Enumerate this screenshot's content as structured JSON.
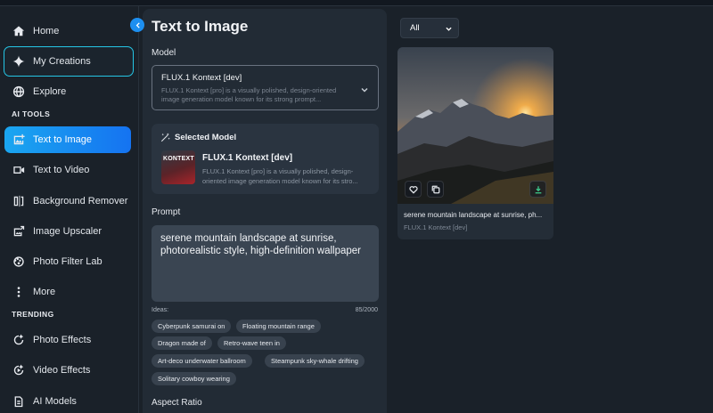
{
  "sidebar": {
    "items": [
      {
        "label": "Home",
        "icon": "home-icon"
      },
      {
        "label": "My Creations",
        "icon": "sparkle-icon"
      },
      {
        "label": "Explore",
        "icon": "globe-icon"
      },
      {
        "label": "Text to Image",
        "icon": "image-plus-icon"
      },
      {
        "label": "Text to Video",
        "icon": "video-icon"
      },
      {
        "label": "Background Remover",
        "icon": "split-icon"
      },
      {
        "label": "Image Upscaler",
        "icon": "upscale-icon"
      },
      {
        "label": "Photo Filter Lab",
        "icon": "filter-icon"
      },
      {
        "label": "More",
        "icon": "more-icon"
      },
      {
        "label": "Photo Effects",
        "icon": "photo-effects-icon"
      },
      {
        "label": "Video Effects",
        "icon": "video-effects-icon"
      },
      {
        "label": "AI Models",
        "icon": "ai-models-icon"
      }
    ],
    "section_ai_tools": "AI TOOLS",
    "section_trending": "TRENDING",
    "active_color": "#1a8ef0",
    "outline_color": "#25c6e6"
  },
  "panel": {
    "title": "Text to Image",
    "model_label": "Model",
    "model_select": {
      "name": "FLUX.1 Kontext [dev]",
      "desc": "FLUX.1 Kontext [pro] is a visually polished, design-oriented image generation model known for its strong prompt..."
    },
    "selected_model": {
      "header": "Selected Model",
      "thumb_text": "KONTEXT",
      "name": "FLUX.1 Kontext [dev]",
      "desc": "FLUX.1 Kontext [pro] is a visually polished, design-oriented image generation model known for its stro..."
    },
    "prompt_label": "Prompt",
    "prompt_value": "serene mountain landscape at sunrise, photorealistic style, high-definition wallpaper",
    "ideas_label": "Ideas:",
    "char_count": "85/2000",
    "ideas": [
      "Cyberpunk samurai on",
      "Floating mountain range",
      "Dragon made of",
      "Retro-wave teen in",
      "Art-deco underwater ballroom",
      "Steampunk sky-whale drifting",
      "Solitary cowboy wearing"
    ],
    "aspect_label": "Aspect Ratio"
  },
  "gallery": {
    "filter_value": "All",
    "cards": [
      {
        "caption": "serene mountain landscape at sunrise, ph...",
        "model": "FLUX.1 Kontext [dev]"
      }
    ]
  }
}
